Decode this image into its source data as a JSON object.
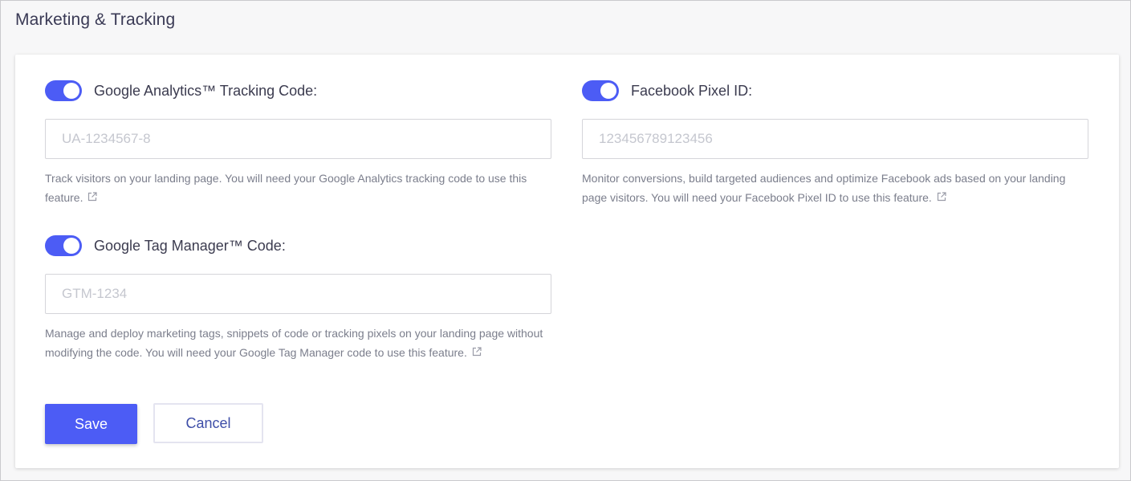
{
  "section": {
    "title": "Marketing & Tracking"
  },
  "fields": {
    "google_analytics": {
      "enabled": true,
      "label": "Google Analytics™ Tracking Code:",
      "value": "",
      "placeholder": "UA-1234567-8",
      "help": "Track visitors on your landing page. You will need your Google Analytics tracking code to use this feature."
    },
    "facebook_pixel": {
      "enabled": true,
      "label": "Facebook Pixel ID:",
      "value": "",
      "placeholder": "123456789123456",
      "help": "Monitor conversions, build targeted audiences and optimize Facebook ads based on your landing page visitors. You will need your Facebook Pixel ID to use this feature."
    },
    "tag_manager": {
      "enabled": true,
      "label": "Google Tag Manager™ Code:",
      "value": "",
      "placeholder": "GTM-1234",
      "help": "Manage and deploy marketing tags, snippets of code or tracking pixels on your landing page without modifying the code. You will need your Google Tag Manager code to use this feature."
    }
  },
  "icons": {
    "toggle": "toggle-switch-icon",
    "external": "external-link-icon"
  },
  "actions": {
    "save_label": "Save",
    "cancel_label": "Cancel"
  },
  "colors": {
    "accent": "#4c5cf5",
    "title_text": "#3a3a55",
    "help_text": "#7b7e8c",
    "cancel_text": "#3e4ea8"
  }
}
